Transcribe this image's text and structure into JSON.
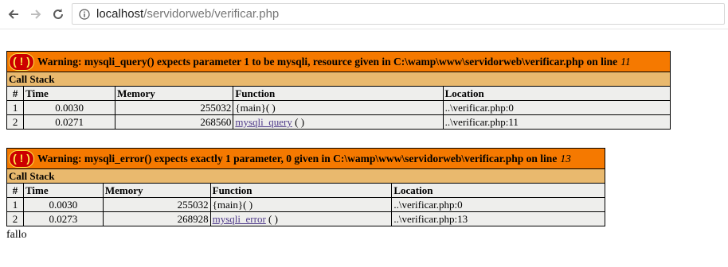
{
  "browser": {
    "url_host": "localhost",
    "url_path": "/servidorweb/verificar.php"
  },
  "warnings": [
    {
      "label": "Warning",
      "message": ": mysqli_query() expects parameter 1 to be mysqli, resource given in C:\\wamp\\www\\servidorweb\\verificar.php on line",
      "line": "11",
      "stack_title": "Call Stack",
      "headers": [
        "#",
        "Time",
        "Memory",
        "Function",
        "Location"
      ],
      "rows": [
        {
          "n": "1",
          "time": "0.0030",
          "memory": "255032",
          "function": "{main}",
          "args": "( )",
          "link": false,
          "location": "..\\verificar.php:0"
        },
        {
          "n": "2",
          "time": "0.0271",
          "memory": "268560",
          "function": "mysqli_query",
          "args": " ( )",
          "link": true,
          "location": "..\\verificar.php:11"
        }
      ]
    },
    {
      "label": "Warning",
      "message": ": mysqli_error() expects exactly 1 parameter, 0 given in C:\\wamp\\www\\servidorweb\\verificar.php on line",
      "line": "13",
      "stack_title": "Call Stack",
      "headers": [
        "#",
        "Time",
        "Memory",
        "Function",
        "Location"
      ],
      "rows": [
        {
          "n": "1",
          "time": "0.0030",
          "memory": "255032",
          "function": "{main}",
          "args": "( )",
          "link": false,
          "location": "..\\verificar.php:0"
        },
        {
          "n": "2",
          "time": "0.0273",
          "memory": "268928",
          "function": "mysqli_error",
          "args": " ( )",
          "link": true,
          "location": "..\\verificar.php:13"
        }
      ]
    }
  ],
  "output_text": "fallo"
}
